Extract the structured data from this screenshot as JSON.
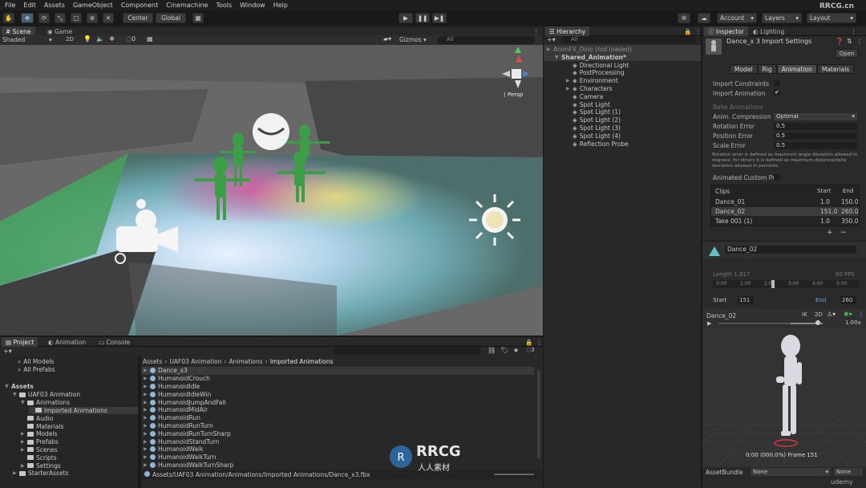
{
  "menu": [
    "File",
    "Edit",
    "Assets",
    "GameObject",
    "Component",
    "Cinemachine",
    "Tools",
    "Window",
    "Help"
  ],
  "toolbar": {
    "center_label": "Center",
    "global_label": "Global",
    "account_label": "Account",
    "layers_label": "Layers",
    "layout_label": "Layout",
    "watermark": "RRCG.cn"
  },
  "scene": {
    "tab_scene": "Scene",
    "tab_game": "Game",
    "shading_mode": "Shaded",
    "mode_2d": "2D",
    "gizmos_label": "Gizmos",
    "search_placeholder": "All",
    "persp_label": "Persp"
  },
  "hierarchy": {
    "tab_label": "Hierarchy",
    "search_placeholder": "All",
    "scene_name": "AnimFX_Dino (not loaded)",
    "root": "Shared_Animation*",
    "items": [
      "Directional Light",
      "PostProcessing",
      "Environment",
      "Characters",
      "Camera",
      "Spot Light",
      "Spot Light (1)",
      "Spot Light (2)",
      "Spot Light (3)",
      "Spot Light (4)",
      "Reflection Probe"
    ]
  },
  "inspector": {
    "tab_inspector": "Inspector",
    "tab_lighting": "Lighting",
    "title": "Dance_x 3 Import Settings",
    "open_button": "Open",
    "tabs": [
      "Model",
      "Rig",
      "Animation",
      "Materials"
    ],
    "import_constraints": "Import Constraints",
    "import_animation": "Import Animation",
    "bake_animations": "Bake Animations",
    "anim_compression_label": "Anim. Compression",
    "anim_compression_value": "Optimal",
    "rotation_error_label": "Rotation Error",
    "rotation_error_value": "0.5",
    "position_error_label": "Position Error",
    "position_error_value": "0.5",
    "scale_error_label": "Scale Error",
    "scale_error_value": "0.5",
    "help_text": "Rotation error is defined as maximum angle deviation allowed in degrees, for others it is defined as maximum distance/delta deviation allowed in percents",
    "animated_custom_props": "Animated Custom Pr",
    "clips_header": "Clips",
    "start_header": "Start",
    "end_header": "End",
    "clips": [
      {
        "name": "Dance_01",
        "start": "1.0",
        "end": "150.0"
      },
      {
        "name": "Dance_02",
        "start": "151.0",
        "end": "260.0"
      },
      {
        "name": "Take 001 (1)",
        "start": "1.0",
        "end": "350.0"
      }
    ],
    "clip_name": "Dance_02",
    "length_label": "Length",
    "length_value": "1.817",
    "fps_label": "60 FPS",
    "timeline_ticks": [
      "0:00",
      "1:00",
      "2:00",
      "3:00",
      "4:00",
      "5:00"
    ],
    "start_label": "Start",
    "start_value": "151",
    "end_label": "End",
    "end_value": "260",
    "preview_clip": "Dance_02",
    "preview_speed": "1.00x",
    "preview_frame": "0:00 (000.0%) Frame 151",
    "assetbundle_label": "AssetBundle",
    "assetbundle_value": "None",
    "assetbundle_variant": "None"
  },
  "project": {
    "tab_project": "Project",
    "tab_animation": "Animation",
    "tab_console": "Console",
    "favorites": [
      "All Models",
      "All Prefabs"
    ],
    "tree_root": "Assets",
    "tree": [
      {
        "label": "UAF03 Animation",
        "depth": 1
      },
      {
        "label": "Animations",
        "depth": 2
      },
      {
        "label": "Imported Animations",
        "depth": 3
      },
      {
        "label": "Audio",
        "depth": 2
      },
      {
        "label": "Materials",
        "depth": 2
      },
      {
        "label": "Models",
        "depth": 2
      },
      {
        "label": "Prefabs",
        "depth": 2
      },
      {
        "label": "Scenes",
        "depth": 2
      },
      {
        "label": "Scripts",
        "depth": 2
      },
      {
        "label": "Settings",
        "depth": 2
      },
      {
        "label": "StarterAssets",
        "depth": 1
      }
    ],
    "breadcrumb": [
      "Assets",
      "UAF03 Animation",
      "Animations",
      "Imported Animations"
    ],
    "files": [
      "Dance_x3",
      "HumanoidCrouch",
      "HumanoidIdle",
      "HumanoidIdleWin",
      "HumanoidJumpAndFall",
      "HumanoidMidAir",
      "HumanoidRun",
      "HumanoidRunTurn",
      "HumanoidRunTurnSharp",
      "HumanoidStandTurn",
      "HumanoidWalk",
      "HumanoidWalkTurn",
      "HumanoidWalkTurnSharp"
    ],
    "path": "Assets/UAF03 Animation/Animations/Imported Animations/Dance_x3.fbx",
    "count_badge": "3"
  },
  "watermarks": {
    "logo_text": "RRCG",
    "logo_sub": "人人素材",
    "udemy": "udemy"
  },
  "colors": {
    "selection": "#2c5d87",
    "panel": "#282828",
    "accent_green": "#3aa046"
  }
}
